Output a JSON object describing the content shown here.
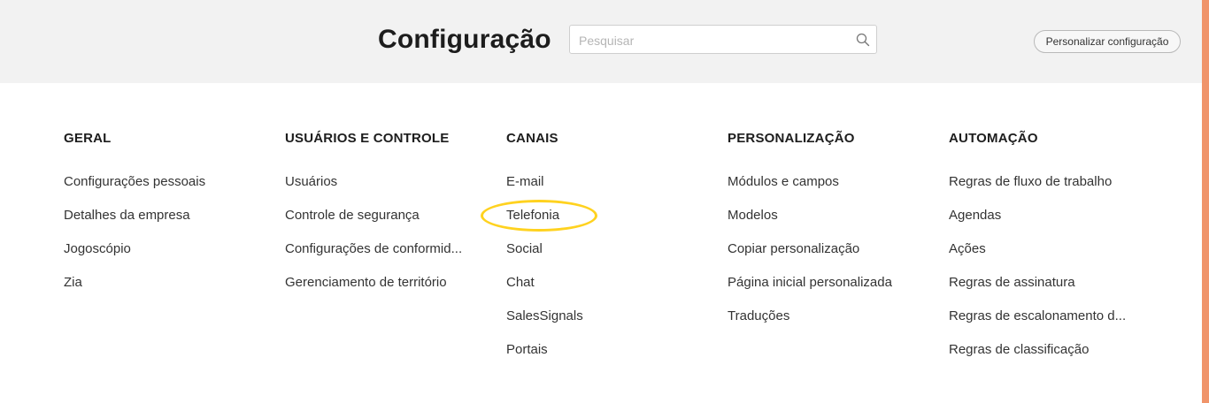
{
  "header": {
    "title": "Configuração",
    "search_placeholder": "Pesquisar",
    "search_value": "",
    "customize_label": "Personalizar configuração"
  },
  "columns": [
    {
      "title": "GERAL",
      "items": [
        "Configurações pessoais",
        "Detalhes da empresa",
        "Jogoscópio",
        "Zia"
      ]
    },
    {
      "title": "USUÁRIOS E CONTROLE",
      "items": [
        "Usuários",
        "Controle de segurança",
        "Configurações de conformid...",
        "Gerenciamento de território"
      ]
    },
    {
      "title": "CANAIS",
      "items": [
        "E-mail",
        "Telefonia",
        "Social",
        "Chat",
        "SalesSignals",
        "Portais"
      ]
    },
    {
      "title": "PERSONALIZAÇÃO",
      "items": [
        "Módulos e campos",
        "Modelos",
        "Copiar personalização",
        "Página inicial personalizada",
        "Traduções"
      ]
    },
    {
      "title": "AUTOMAÇÃO",
      "items": [
        "Regras de fluxo de trabalho",
        "Agendas",
        "Ações",
        "Regras de assinatura",
        "Regras de escalonamento d...",
        "Regras de classificação"
      ]
    }
  ],
  "highlight": {
    "target": "Telefonia",
    "color": "#ffd21f"
  },
  "colors": {
    "header_bg": "#f2f2f2",
    "scrollbar": "#f0946a"
  },
  "icons": {
    "search": "search-icon"
  }
}
